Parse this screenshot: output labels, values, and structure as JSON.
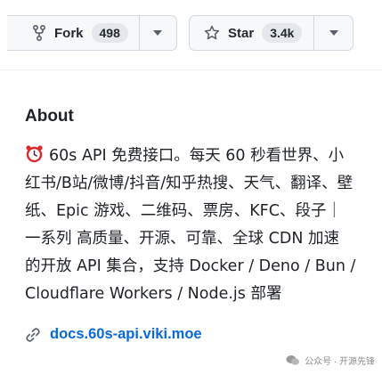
{
  "fork": {
    "label": "Fork",
    "count": "498"
  },
  "star": {
    "label": "Star",
    "count": "3.4k"
  },
  "about": {
    "title": "About",
    "description": "60s API 免费接口。每天 60 秒看世界、小红书/B站/微博/抖音/知乎热搜、天气、翻译、壁纸、Epic 游戏、二维码、票房、KFC、段子｜一系列 高质量、开源、可靠、全球 CDN 加速 的开放 API 集合，支持 Docker / Deno / Bun / Cloudflare Workers / Node.js 部署",
    "link": "docs.60s-api.viki.moe"
  },
  "watermark": {
    "text": "公众号 · 开源先锋"
  },
  "colors": {
    "accent_link": "#0969da",
    "button_bg": "#f6f8fa",
    "border": "#d0d7de"
  }
}
